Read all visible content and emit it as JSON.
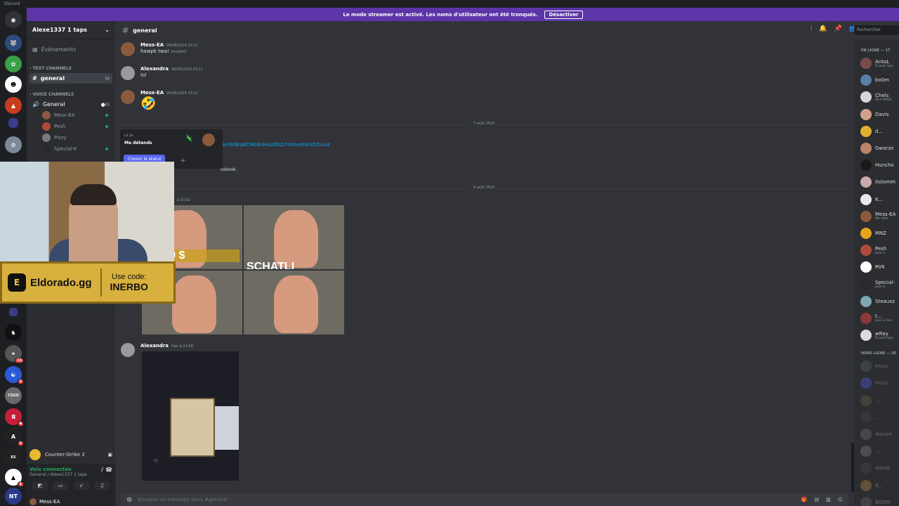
{
  "app": {
    "title": "Discord"
  },
  "banner": {
    "text": "Le mode streamer est activé. Les noms d'utilisateur ont été tronqués.",
    "button": "Désactiver"
  },
  "server": {
    "name": "Alexe1337 1 taps",
    "events": "Événements"
  },
  "sidebar": {
    "text_category": "TEXT CHANNELS",
    "text_channels": [
      "general"
    ],
    "voice_category": "VOICE CHANNELS",
    "voice_channel": "General",
    "voice_users": [
      "Mess-EA",
      "Pesh",
      "Pizzy",
      "Special-K"
    ]
  },
  "rail_badges": [
    "11",
    "1",
    "4",
    "1",
    "1"
  ],
  "game_activity": {
    "name": "Counter-Strike 2"
  },
  "voice_panel": {
    "status": "Voix connectée",
    "location": "General / Alexe1337 1 taps"
  },
  "user_panel": {
    "name": "Mess-EA"
  },
  "channel_header": {
    "name": "general"
  },
  "search": {
    "placeholder": "Rechercher"
  },
  "messages": [
    {
      "author": "Mess-EA",
      "time": "06/08/2024 23:11",
      "text": "hawpk twa!",
      "edited": "(modifié)"
    },
    {
      "author": "Alexandra",
      "time": "06/08/2024 23:11",
      "text": "lol"
    },
    {
      "author": "Mess-EA",
      "time": "06/08/2024 23:11",
      "text": "🤣"
    }
  ],
  "date_dividers": [
    "7 août 2024",
    "9 août 2024"
  ],
  "link_text": "e/r/83Eq8CMoBnHAaDh2/?mibextid=D5vuiz",
  "partial_text": "cebook.",
  "image_time": "à 23:02",
  "meme_captions": [
    "0 000 $",
    "SCHATLI"
  ],
  "video_message": {
    "author": "Alexandra",
    "time": "Hier à 23:68"
  },
  "status_popup": {
    "line1": "Là je-",
    "line2": "Me détends",
    "button": "Choisir le statut"
  },
  "promo": {
    "brand": "Eldorado.gg",
    "line1": "Use code:",
    "code": "INERBO"
  },
  "composer": {
    "placeholder": "Envoyer un message dans #general"
  },
  "members_online": {
    "header": "EN LIGNE — 17",
    "list": [
      {
        "name": "AntoL",
        "activity": "Écoute Spo",
        "color": "#7a4b4b"
      },
      {
        "name": "bo0m",
        "activity": "",
        "color": "#5a7fa8"
      },
      {
        "name": "Chels",
        "activity": "IN A WAVE",
        "color": "#d6d6d6"
      },
      {
        "name": "Davis",
        "activity": "",
        "color": "#d2a089"
      },
      {
        "name": "d...",
        "activity": "",
        "color": "#e0b030"
      },
      {
        "name": "Gwarzo",
        "activity": "",
        "color": "#b9866a"
      },
      {
        "name": "Huncho",
        "activity": "",
        "color": "#1a1a1a"
      },
      {
        "name": "itstomm",
        "activity": "",
        "color": "#c9a9a9"
      },
      {
        "name": "K...",
        "activity": "",
        "color": "#e8e8e8"
      },
      {
        "name": "Mess-EA",
        "activity": "Me déte",
        "color": "#8b5a3c"
      },
      {
        "name": "MNZ",
        "activity": "",
        "color": "#e7a21e"
      },
      {
        "name": "Pesh",
        "activity": "Joue à",
        "color": "#b04a3a"
      },
      {
        "name": "RVK",
        "activity": "",
        "color": "#ffffff"
      },
      {
        "name": "Special-",
        "activity": "Joue à",
        "color": "#2a2a2a"
      },
      {
        "name": "Steauxz",
        "activity": "",
        "color": "#7fa8b0"
      },
      {
        "name": "t...",
        "activity": "Joue à Cou",
        "color": "#8b3a3a"
      },
      {
        "name": "wRay",
        "activity": "Écoute Spo",
        "color": "#dcdcdc"
      }
    ]
  },
  "members_offline": {
    "header": "HORS LIGNE — 30",
    "list": [
      {
        "name": "truco",
        "color": "#5a6a5a"
      },
      {
        "name": "truco",
        "color": "#5865f2"
      },
      {
        "name": "...",
        "color": "#6a6a4a"
      },
      {
        "name": "...",
        "color": "#4a4a4a"
      },
      {
        "name": "Alexan",
        "color": "#7a7a7a"
      },
      {
        "name": "...",
        "color": "#8a8a8a"
      },
      {
        "name": "Alexik",
        "color": "#4a4a4a"
      },
      {
        "name": "B...",
        "color": "#c9953a"
      },
      {
        "name": "BOOM",
        "color": "#6a6a6a"
      }
    ]
  }
}
